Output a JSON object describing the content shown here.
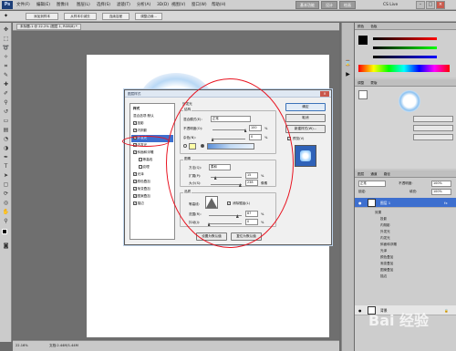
{
  "menubar": {
    "logo": "Ps",
    "items": [
      "文件(F)",
      "编辑(E)",
      "图像(I)",
      "图层(L)",
      "选择(S)",
      "滤镜(T)",
      "分析(A)",
      "3D(D)",
      "视图(V)",
      "窗口(W)",
      "帮助(H)"
    ],
    "workspace_buttons": [
      "基本功能",
      "设计",
      "绘画"
    ],
    "cs_live": "CS Live"
  },
  "options_bar": {
    "buttons": [
      "添加到样本",
      "从样本中减去",
      "连续容差",
      "调整边缘..."
    ]
  },
  "document": {
    "tab_title": "未标题-1 @ 22.2% (图层 1, RGB/8) *",
    "zoom": "22.16%",
    "status": "文档:2.44M/1.44M"
  },
  "right_panels": {
    "color_tab": "颜色",
    "swatch_tab": "色板",
    "adjust_tab": "调整",
    "mask_tab": "蒙版",
    "layers_tab": "图层",
    "channels_tab": "通道",
    "paths_tab": "路径",
    "blend_mode": "正常",
    "opacity_label": "不透明度:",
    "opacity_value": "100%",
    "fill_label": "填充:",
    "fill_value": "100%",
    "lock_label": "锁定:",
    "layer1_name": "图层 1",
    "effects_label": "效果",
    "layer_effects": [
      "投影",
      "内阴影",
      "外发光",
      "内发光",
      "斜面和浮雕",
      "光泽",
      "颜色叠加",
      "渐变叠加",
      "图案叠加",
      "描边"
    ],
    "background_name": "背景"
  },
  "dialog": {
    "title": "图层样式",
    "styles_header": "样式",
    "blend_options": "混合选项:默认",
    "styles": [
      {
        "label": "投影",
        "checked": true
      },
      {
        "label": "内阴影",
        "checked": true
      },
      {
        "label": "外发光",
        "checked": true,
        "selected": true
      },
      {
        "label": "内发光",
        "checked": true
      },
      {
        "label": "斜面和浮雕",
        "checked": true
      },
      {
        "label": "等高线",
        "checked": false,
        "sub": true
      },
      {
        "label": "纹理",
        "checked": false,
        "sub": true
      },
      {
        "label": "光泽",
        "checked": true
      },
      {
        "label": "颜色叠加",
        "checked": true
      },
      {
        "label": "渐变叠加",
        "checked": true
      },
      {
        "label": "图案叠加",
        "checked": true
      },
      {
        "label": "描边",
        "checked": true
      }
    ],
    "section_title": "外发光",
    "structure": {
      "title": "结构",
      "blend_label": "混合模式(E):",
      "blend_value": "正常",
      "opacity_label": "不透明度(O):",
      "opacity_value": "100",
      "opacity_level": 1.0,
      "noise_label": "杂色(N):",
      "noise_value": "0",
      "noise_level": 0.0,
      "unit": "%",
      "swatch_color": "#ffffa8"
    },
    "elements": {
      "title": "图素",
      "method_label": "方法(Q):",
      "method_value": "柔和",
      "spread_label": "扩展(P):",
      "spread_value": "15",
      "spread_level": 0.15,
      "size_label": "大小(S):",
      "size_value": "238",
      "size_level": 0.95,
      "px": "像素",
      "pct": "%"
    },
    "quality": {
      "title": "品质",
      "contour_label": "等高线:",
      "antialias_label": "消除锯齿(L)",
      "range_label": "范围(R):",
      "range_value": "87",
      "range_level": 0.87,
      "jitter_label": "抖动(J):",
      "jitter_value": "0",
      "jitter_level": 0.0,
      "pct": "%"
    },
    "default_buttons": [
      "设置为默认值",
      "复位为默认值"
    ],
    "ok": "确定",
    "cancel": "取消",
    "new_style": "新建样式(W)...",
    "preview_label": "预览(V)"
  },
  "watermark": "Bai 经验"
}
